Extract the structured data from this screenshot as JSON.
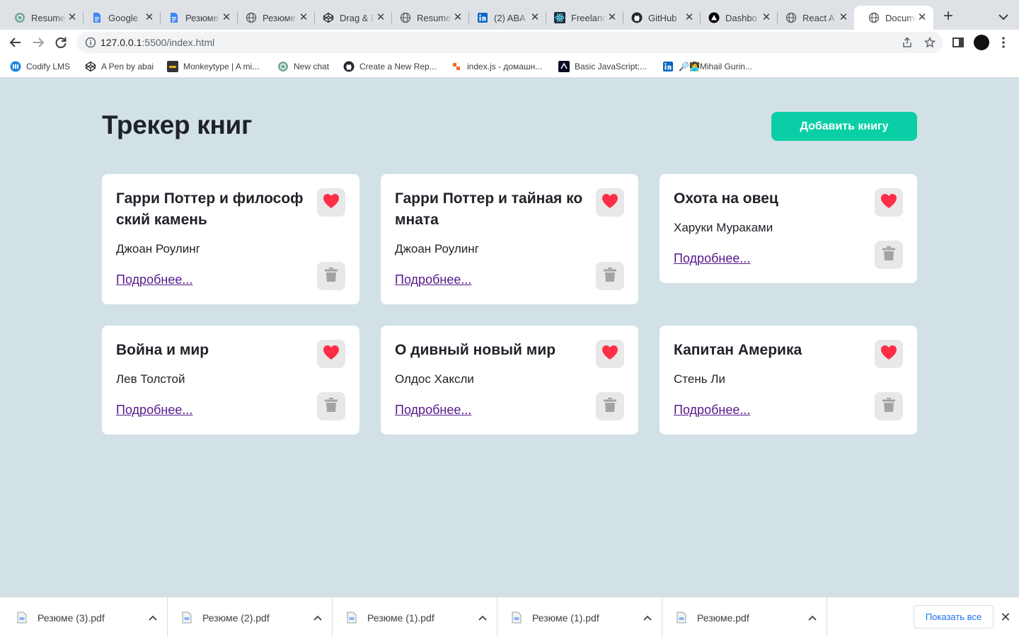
{
  "browser": {
    "tabs": [
      {
        "title": "Resume",
        "icon": "chatgpt-icon"
      },
      {
        "title": "Google",
        "icon": "google-docs-icon"
      },
      {
        "title": "Резюме",
        "icon": "google-docs-icon"
      },
      {
        "title": "Резюме",
        "icon": "globe-icon"
      },
      {
        "title": "Drag & D",
        "icon": "codepen-icon"
      },
      {
        "title": "Resume",
        "icon": "globe-icon"
      },
      {
        "title": "(2) ABA",
        "icon": "linkedin-icon"
      },
      {
        "title": "Freelanc",
        "icon": "react-icon"
      },
      {
        "title": "GitHub",
        "icon": "github-icon"
      },
      {
        "title": "Dashbo",
        "icon": "vercel-icon"
      },
      {
        "title": "React A",
        "icon": "globe-icon"
      },
      {
        "title": "Docume",
        "icon": "globe-icon"
      }
    ],
    "active_tab": 11,
    "address": {
      "host": "127.0.0.1",
      "rest": ":5500/index.html"
    },
    "bookmarks": [
      {
        "label": "Codify LMS",
        "icon": "codify-icon"
      },
      {
        "label": "A Pen by abai",
        "icon": "codepen-icon"
      },
      {
        "label": "Monkeytype | A mi...",
        "icon": "monkeytype-icon"
      },
      {
        "label": "New chat",
        "icon": "chatgpt-icon"
      },
      {
        "label": "Create a New Rep...",
        "icon": "github-icon"
      },
      {
        "label": "index.js - домашн...",
        "icon": "codesandbox-icon"
      },
      {
        "label": "Basic JavaScript:...",
        "icon": "freecodecamp-icon"
      },
      {
        "label": "🔎👩‍💻Mihail Gurin...",
        "icon": "linkedin-icon"
      }
    ]
  },
  "app": {
    "title": "Трекер книг",
    "add_button": "Добавить книгу",
    "more_label": "Подробнее...",
    "books": [
      {
        "title": "Гарри Поттер и философский камень",
        "author": "Джоан Роулинг",
        "favorite": true
      },
      {
        "title": "Гарри Поттер и тайная комната",
        "author": "Джоан Роулинг",
        "favorite": true
      },
      {
        "title": "Охота на овец",
        "author": "Харуки Мураками",
        "favorite": true
      },
      {
        "title": "Война и мир",
        "author": "Лев Толстой",
        "favorite": true
      },
      {
        "title": "О дивный новый мир",
        "author": "Олдос Хаксли",
        "favorite": true
      },
      {
        "title": "Капитан Америка",
        "author": "Стень Ли",
        "favorite": true
      }
    ]
  },
  "downloads": {
    "files": [
      "Резюме (3).pdf",
      "Резюме (2).pdf",
      "Резюме (1).pdf",
      "Резюме (1).pdf",
      "Резюме.pdf"
    ],
    "show_all": "Показать все"
  },
  "colors": {
    "page_bg": "#d2e1e5",
    "accent": "#0acfa6",
    "heart": "#ff2d46",
    "trash": "#a3a3a3",
    "link": "#551a8b"
  }
}
